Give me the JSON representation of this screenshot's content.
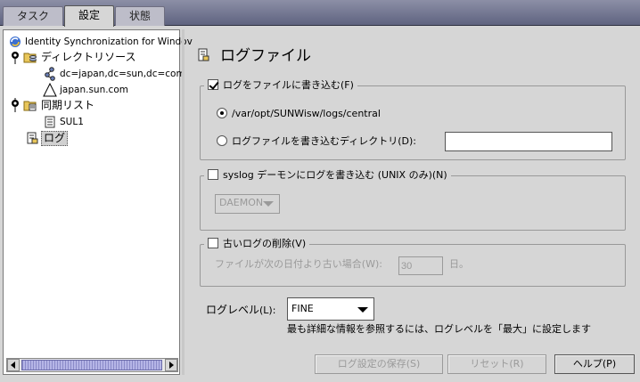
{
  "tabs": [
    {
      "label": "タスク"
    },
    {
      "label": "設定"
    },
    {
      "label": "状態"
    }
  ],
  "tree": {
    "root": "Identity Synchronization for Windov",
    "directory_resources": "ディレクトリソース",
    "dc_item": "dc=japan,dc=sun,dc=com",
    "host_item": "japan.sun.com",
    "sync_list": "同期リスト",
    "sul_item": "SUL1",
    "log_item": "ログ"
  },
  "page": {
    "title": "ログファイル"
  },
  "file_log": {
    "checkbox_label": "ログをファイルに書き込む",
    "mnemonic": "(F)",
    "checked": true,
    "radio_path": "/var/opt/SUNWisw/logs/central",
    "radio_dir_label": "ログファイルを書き込むディレクトリ",
    "radio_dir_mnemonic": "(D):",
    "dir_value": ""
  },
  "syslog": {
    "checkbox_label": "syslog デーモンにログを書き込む (UNIX のみ)",
    "mnemonic": "(N)",
    "checked": false,
    "facility": "DAEMON"
  },
  "purge": {
    "checkbox_label": "古いログの削除",
    "mnemonic": "(V)",
    "checked": false,
    "days_label": "ファイルが次の日付より古い場合",
    "days_mnemonic": "(W):",
    "days_value": "30",
    "days_unit": "日。"
  },
  "log_level": {
    "label": "ログレベル",
    "mnemonic": "(L):",
    "value": "FINE",
    "hint": "最も詳細な情報を参照するには、ログレベルを「最大」に設定します"
  },
  "buttons": {
    "save": "ログ設定の保存(S)",
    "reset": "リセット(R)",
    "help": "ヘルプ(P)"
  }
}
